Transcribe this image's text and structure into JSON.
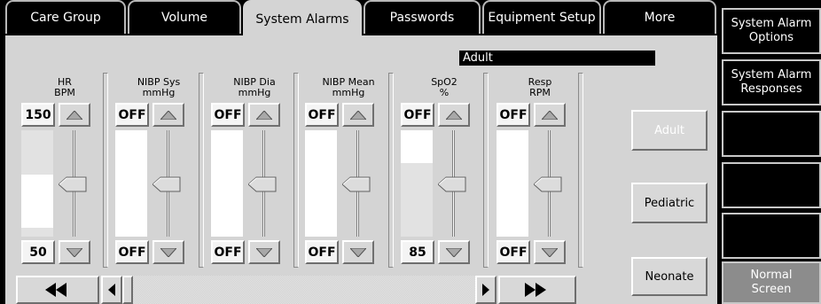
{
  "tabs": [
    {
      "label": "Care Group",
      "active": false
    },
    {
      "label": "Volume",
      "active": false
    },
    {
      "label": "System Alarms",
      "active": true
    },
    {
      "label": "Passwords",
      "active": false
    },
    {
      "label": "Equipment Setup",
      "active": false
    },
    {
      "label": "More",
      "active": false
    }
  ],
  "side_menu": [
    {
      "label": "System Alarm\nOptions"
    },
    {
      "label": "System Alarm\nResponses"
    },
    {
      "label": ""
    },
    {
      "label": ""
    },
    {
      "label": ""
    },
    {
      "label": "Normal\nScreen"
    }
  ],
  "patient_mode": "Adult",
  "parameters": [
    {
      "title": "HR\nBPM",
      "high": "150",
      "low": "50",
      "high_fraction": 0.58,
      "low_fraction": 0.08
    },
    {
      "title": "NIBP Sys\nmmHg",
      "high": "OFF",
      "low": "OFF"
    },
    {
      "title": "NIBP Dia\nmmHg",
      "high": "OFF",
      "low": "OFF"
    },
    {
      "title": "NIBP Mean\nmmHg",
      "high": "OFF",
      "low": "OFF"
    },
    {
      "title": "SpO2\n%",
      "high": "OFF",
      "low": "85",
      "high_fraction": 1.0,
      "low_fraction": 0.69
    },
    {
      "title": "Resp\nRPM",
      "high": "OFF",
      "low": "OFF"
    }
  ],
  "patient_buttons": [
    {
      "label": "Adult",
      "enabled": false
    },
    {
      "label": "Pediatric",
      "enabled": true
    },
    {
      "label": "Neonate",
      "enabled": true
    }
  ],
  "icons": {
    "up": "triangle-up-icon",
    "down": "triangle-down-icon",
    "page_left": "double-left-arrow-icon",
    "page_right": "double-right-arrow-icon",
    "step_left": "left-arrow-icon",
    "step_right": "right-arrow-icon"
  },
  "colors": {
    "panel": "#d4d4d4",
    "tab_border": "#b8b8b8",
    "fill_light": "#e2e2e2"
  }
}
